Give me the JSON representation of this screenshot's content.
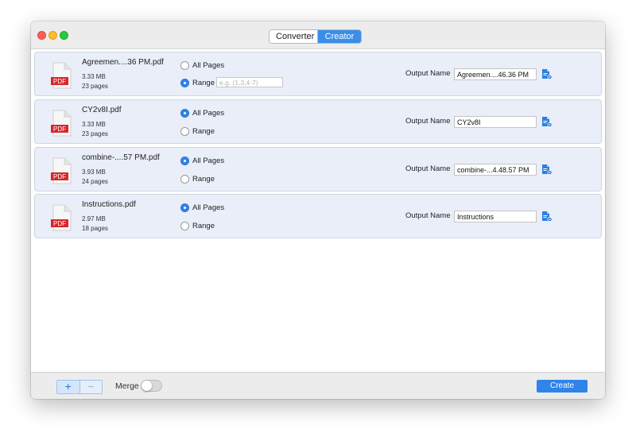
{
  "window": {
    "tabs": {
      "converter": "Converter",
      "creator": "Creator",
      "active": "Creator"
    }
  },
  "pdf_icon_label": "PDF",
  "files": [
    {
      "name": "Agreemen....36 PM.pdf",
      "size": "3.33 MB",
      "pages": "23 pages",
      "all_pages_label": "All Pages",
      "range_label": "Range",
      "selected": "Range",
      "range_placeholder": "e.g. (1,3,4-7)",
      "output_label": "Output Name",
      "output_name": "Agreemen....46.36 PM"
    },
    {
      "name": "CY2v8I.pdf",
      "size": "3.33 MB",
      "pages": "23 pages",
      "all_pages_label": "All Pages",
      "range_label": "Range",
      "selected": "All Pages",
      "output_label": "Output Name",
      "output_name": "CY2v8I"
    },
    {
      "name": "combine-....57 PM.pdf",
      "size": "3.93 MB",
      "pages": "24 pages",
      "all_pages_label": "All Pages",
      "range_label": "Range",
      "selected": "All Pages",
      "output_label": "Output Name",
      "output_name": "combine-...4.48.57 PM"
    },
    {
      "name": "Instructions.pdf",
      "size": "2.97 MB",
      "pages": "18 pages",
      "all_pages_label": "All Pages",
      "range_label": "Range",
      "selected": "All Pages",
      "output_label": "Output Name",
      "output_name": "Instructions"
    }
  ],
  "footer": {
    "add": "+",
    "remove": "−",
    "merge_label": "Merge",
    "merge_on": false,
    "create_label": "Create"
  },
  "colors": {
    "accent": "#2f84ea",
    "row_bg": "#e9eef8",
    "pdf_red": "#d9262b"
  }
}
